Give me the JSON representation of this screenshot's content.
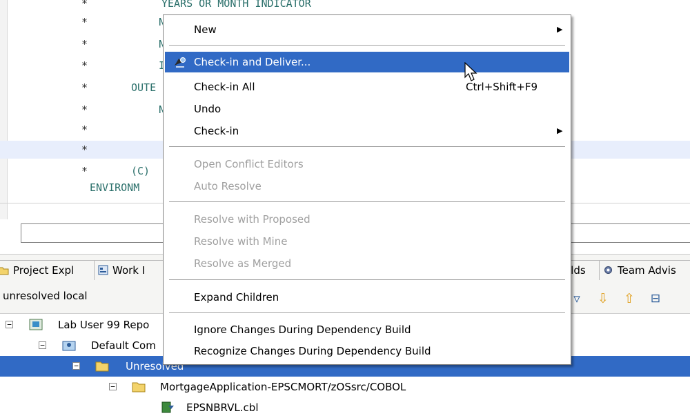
{
  "editor": {
    "lines": [
      {
        "star": "*",
        "text": "YEARS OR MONTH INDICATOR",
        "indent": 234
      },
      {
        "star": "*",
        "text": "N",
        "indent": 230
      },
      {
        "star": "*",
        "text": "N",
        "indent": 230
      },
      {
        "star": "*",
        "text": "I",
        "indent": 230
      },
      {
        "star": "*",
        "text": "OUTE",
        "indent": 190
      },
      {
        "star": "*",
        "text": "N",
        "indent": 230
      },
      {
        "star": "*",
        "text": "",
        "indent": 230
      },
      {
        "star": "*",
        "text": "",
        "indent": 230
      },
      {
        "star": "*",
        "text": "(C)",
        "indent": 190
      },
      {
        "star": "",
        "text": "ENVIRONM",
        "indent": 130
      }
    ]
  },
  "tabs": {
    "project_explorer": "Project Expl",
    "work_items": "Work I",
    "builds": "ilds",
    "team_advisor": "Team Advis"
  },
  "view": {
    "title": "unresolved local"
  },
  "tree": {
    "rows": [
      {
        "label": "Lab User 99 Repo",
        "icon": "repository-icon"
      },
      {
        "label": "Default Com",
        "icon": "component-icon"
      },
      {
        "label": "Unresolved",
        "icon": "folder-icon"
      },
      {
        "label": "MortgageApplication-EPSCMORT/zOSsrc/COBOL",
        "icon": "folder-icon"
      },
      {
        "label": "EPSNBRVL.cbl",
        "icon": "cobol-file-icon"
      }
    ]
  },
  "menu": {
    "new": "New",
    "check_in_deliver": "Check-in and Deliver...",
    "check_in_all": "Check-in All",
    "check_in_all_shortcut": "Ctrl+Shift+F9",
    "undo": "Undo",
    "check_in": "Check-in",
    "open_conflict_editors": "Open Conflict Editors",
    "auto_resolve": "Auto Resolve",
    "resolve_proposed": "Resolve with Proposed",
    "resolve_mine": "Resolve with Mine",
    "resolve_merged": "Resolve as Merged",
    "expand_children": "Expand Children",
    "ignore_changes": "Ignore Changes During Dependency Build",
    "recognize_changes": "Recognize Changes During Dependency Build"
  },
  "colors": {
    "selection": "#316ac5",
    "code_text": "#2a6f6a",
    "disabled_text": "#a0a0a0"
  }
}
